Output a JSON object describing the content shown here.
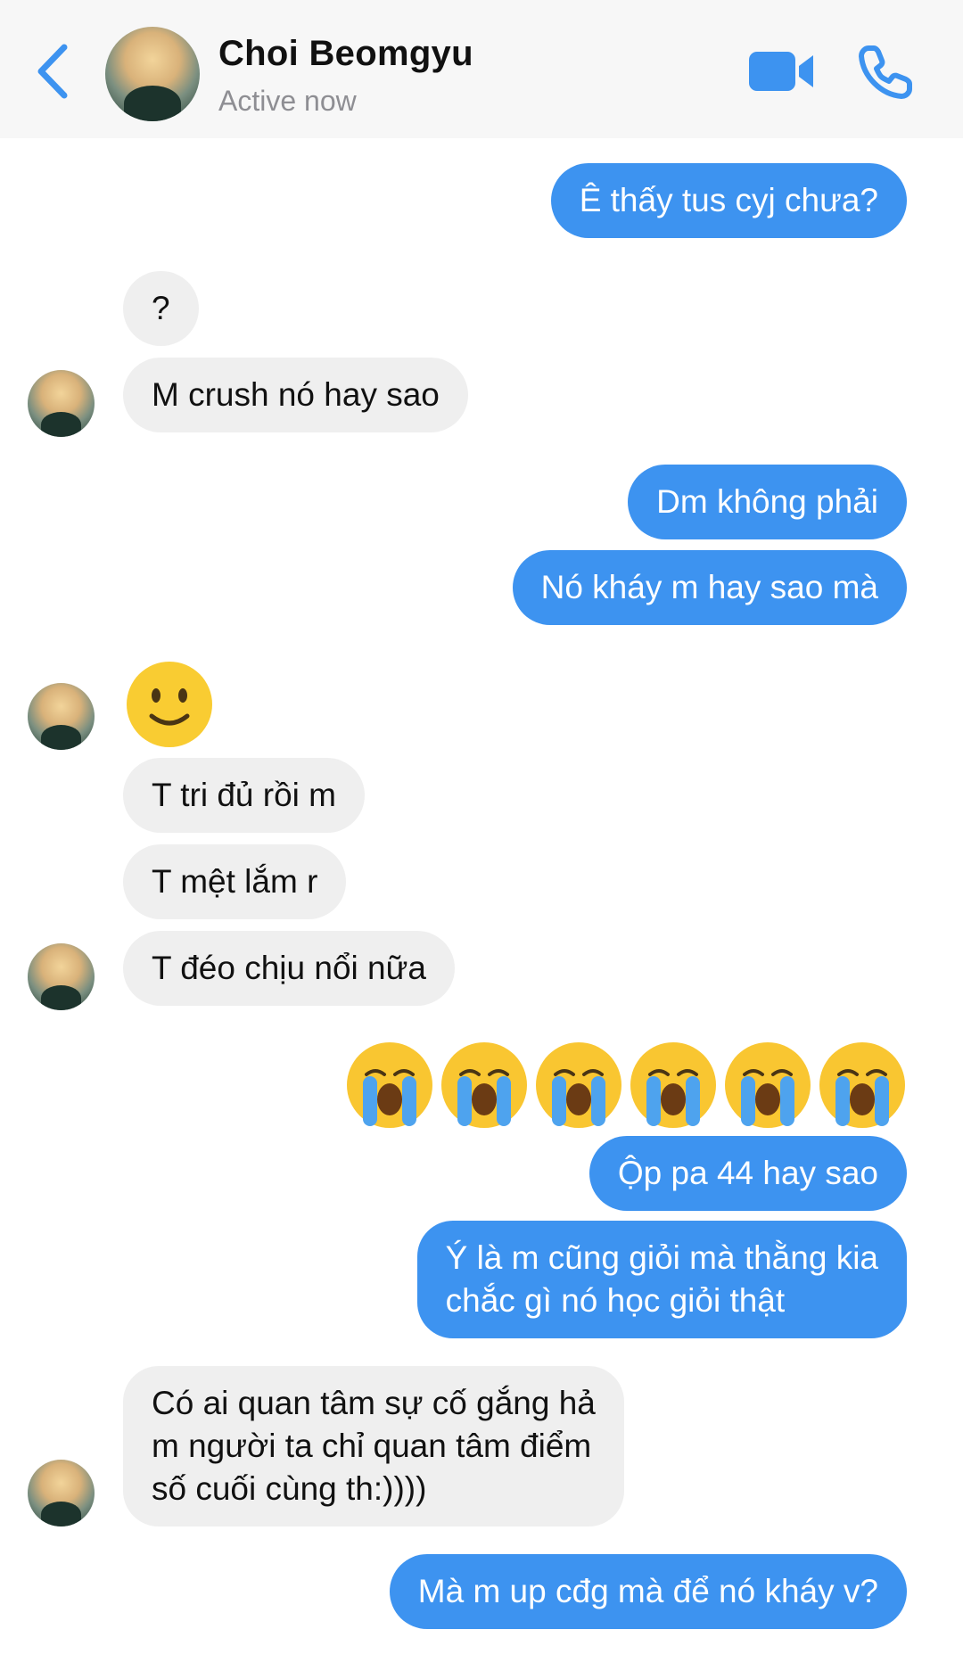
{
  "header": {
    "back_icon": "chevron-left-icon",
    "contact_name": "Choi Beomgyu",
    "status": "Active now",
    "video_icon": "video-camera-icon",
    "call_icon": "phone-icon",
    "accent_color": "#3d93f0"
  },
  "messages": [
    {
      "from": "me",
      "text": "Ê thấy tus cyj chưa?"
    },
    {
      "from": "them",
      "text": "?"
    },
    {
      "from": "them",
      "text": "M crush nó hay sao"
    },
    {
      "from": "me",
      "text": "Dm không phải"
    },
    {
      "from": "me",
      "text": "Nó kháy m hay sao mà"
    },
    {
      "from": "them",
      "emoji": "slightly-smiling-face"
    },
    {
      "from": "them",
      "text": "T tri đủ rồi m"
    },
    {
      "from": "them",
      "text": "T mệt lắm r"
    },
    {
      "from": "them",
      "text": "T đéo chịu nổi nữa"
    },
    {
      "from": "me",
      "emoji": "loudly-crying-face",
      "count": 6
    },
    {
      "from": "me",
      "text": "Ộp pa 44 hay sao"
    },
    {
      "from": "me",
      "text": "Ý là m cũng giỏi mà thằng kia\nchắc gì nó học giỏi thật"
    },
    {
      "from": "them",
      "text": "Có ai quan tâm sự cố gắng hả\nm người ta chỉ quan tâm điểm\nsố cuối cùng th:))))"
    },
    {
      "from": "me",
      "text": "Mà m up cđg mà để nó kháy v?"
    }
  ]
}
